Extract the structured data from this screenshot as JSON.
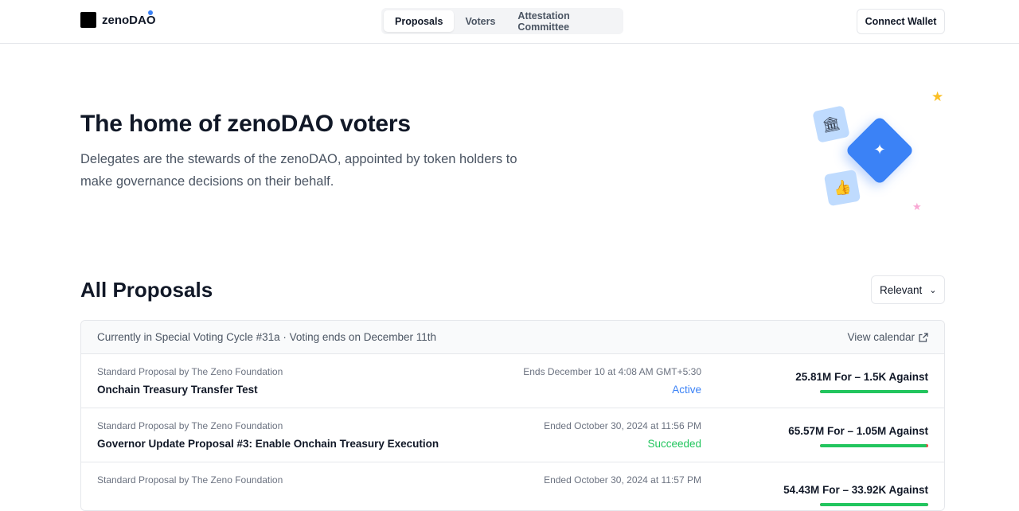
{
  "brand": {
    "name": "zenoDAO"
  },
  "nav": {
    "tabs": [
      {
        "label": "Proposals",
        "active": true
      },
      {
        "label": "Voters",
        "active": false
      },
      {
        "label": "Attestation Committee",
        "active": false
      }
    ],
    "connect_label": "Connect Wallet"
  },
  "hero": {
    "title": "The home of zenoDAO voters",
    "description": "Delegates are the stewards of the zenoDAO, appointed by token holders to make governance decisions on their behalf.",
    "icons": [
      "bank-icon",
      "sparkle-icon",
      "thumbs-up-icon",
      "star-icon"
    ]
  },
  "proposals": {
    "title": "All Proposals",
    "sort_label": "Relevant",
    "cycle_text": "Currently in Special Voting Cycle #31a · Voting ends on December 11th",
    "view_calendar": "View calendar",
    "rows": [
      {
        "by": "Standard Proposal by The Zeno Foundation",
        "title": "Onchain Treasury Transfer Test",
        "date": "Ends December 10 at 4:08 AM GMT+5:30",
        "status": "Active",
        "status_color": "#3b82f6",
        "votes": "25.81M For – 1.5K Against",
        "for_fraction": 0.9999
      },
      {
        "by": "Standard Proposal by The Zeno Foundation",
        "title": "Governor Update Proposal #3: Enable Onchain Treasury Execution",
        "date": "Ended October 30, 2024 at 11:56 PM",
        "status": "Succeeded",
        "status_color": "#22c55e",
        "votes": "65.57M For – 1.05M Against",
        "for_fraction": 0.984
      },
      {
        "by": "Standard Proposal by The Zeno Foundation",
        "title": "",
        "date": "Ended October 30, 2024 at 11:57 PM",
        "status": "",
        "status_color": "#22c55e",
        "votes": "54.43M For – 33.92K Against",
        "for_fraction": 0.999
      }
    ]
  },
  "colors": {
    "accent": "#3b82f6",
    "for": "#22c55e",
    "against": "#ef4444"
  }
}
